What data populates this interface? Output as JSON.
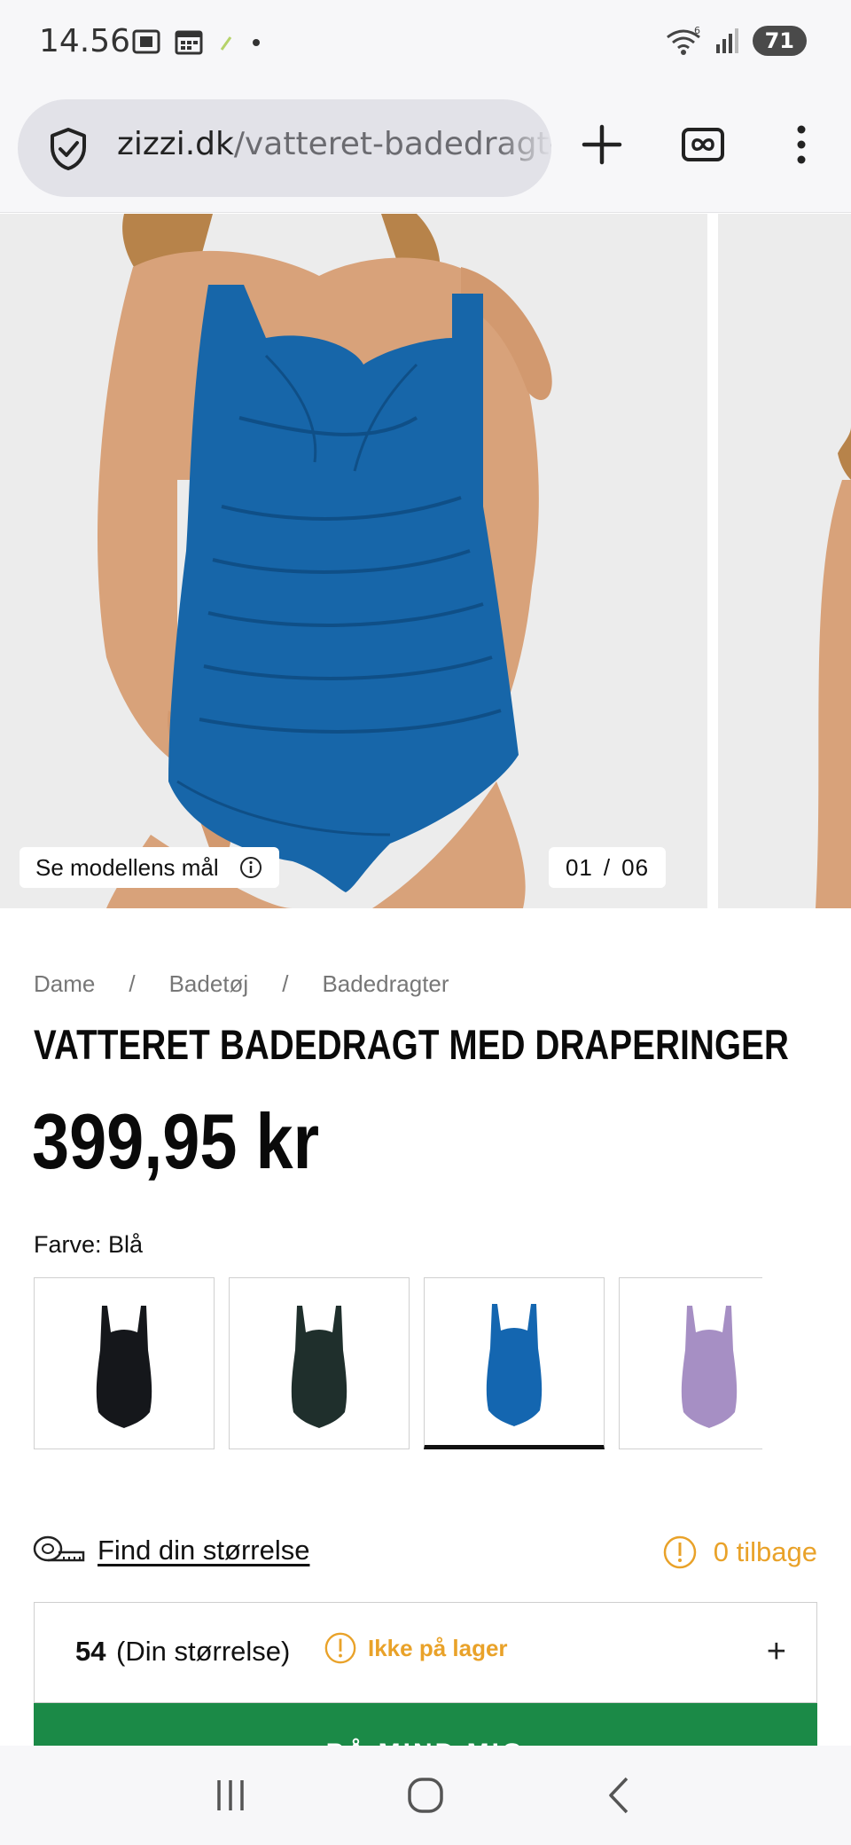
{
  "status_bar": {
    "time": "14.56",
    "battery": "71"
  },
  "browser": {
    "url_domain": "zizzi.dk",
    "url_path": "/vatteret-badedragt-med-draperinger",
    "icons": [
      "shield-check-icon",
      "new-tab-icon",
      "tabs-infinity-icon",
      "more-menu-icon"
    ]
  },
  "gallery": {
    "model_info_label": "Se modellens mål",
    "counter_current": "01",
    "counter_separator": "/",
    "counter_total": "06"
  },
  "breadcrumb": {
    "items": [
      "Dame",
      "Badetøj",
      "Badedragter"
    ],
    "separator": "/"
  },
  "product": {
    "title": "VATTERET BADEDRAGT MED DRAPERINGER",
    "price": "399,95 kr",
    "color_label": "Farve: Blå"
  },
  "swatches": {
    "selected_index": 2,
    "colors": [
      "#15171b",
      "#1f2f2c",
      "#1466b0",
      "#a68fc4"
    ]
  },
  "size": {
    "finder_label": "Find din størrelse",
    "stock_left": "0 tilbage",
    "selected_size": "54",
    "selected_hint": "(Din størrelse)",
    "stock_status": "Ikke på lager",
    "expand_symbol": "+",
    "remind_button": "PÅ MIND MIG"
  },
  "colors": {
    "accent_green": "#1b8a47",
    "warning_orange": "#e9a229"
  }
}
